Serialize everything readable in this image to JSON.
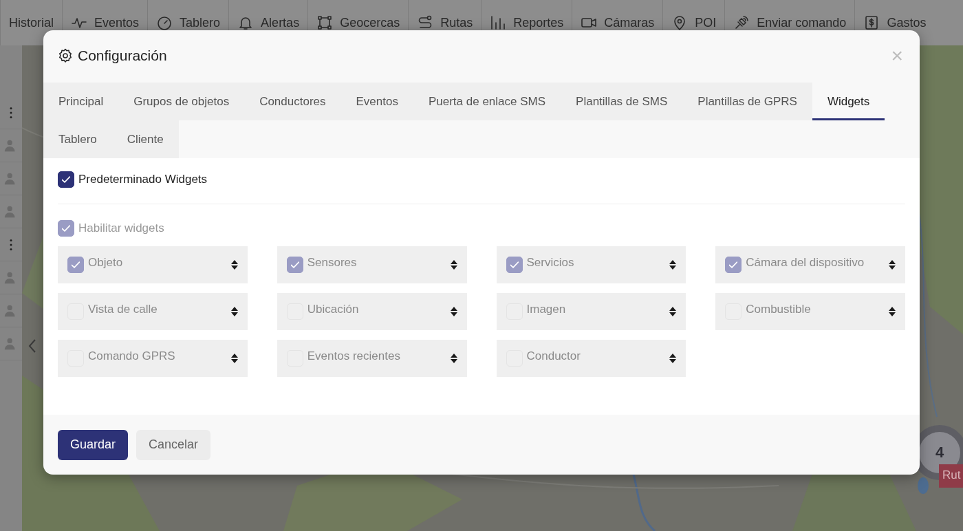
{
  "nav": {
    "items": [
      {
        "label": "Historial"
      },
      {
        "label": "Eventos"
      },
      {
        "label": "Tablero"
      },
      {
        "label": "Alertas"
      },
      {
        "label": "Geocercas"
      },
      {
        "label": "Rutas"
      },
      {
        "label": "Reportes"
      },
      {
        "label": "Cámaras"
      },
      {
        "label": "POI"
      },
      {
        "label": "Enviar comando"
      },
      {
        "label": "Gastos"
      }
    ]
  },
  "map": {
    "kind": "picture",
    "cluster": {
      "count": "4"
    },
    "tag": {
      "label": "Rut"
    }
  },
  "modal": {
    "title": "Configuración",
    "close": "×",
    "tabs": [
      {
        "label": "Principal",
        "selected": false
      },
      {
        "label": "Grupos de objetos",
        "selected": false
      },
      {
        "label": "Conductores",
        "selected": false
      },
      {
        "label": "Eventos",
        "selected": false
      },
      {
        "label": "Puerta de enlace SMS",
        "selected": false
      },
      {
        "label": "Plantillas de SMS",
        "selected": false
      },
      {
        "label": "Plantillas de GPRS",
        "selected": false
      },
      {
        "label": "Widgets",
        "selected": true
      },
      {
        "label": "Tablero",
        "selected": false
      },
      {
        "label": "Cliente",
        "selected": false
      }
    ],
    "default_widgets": {
      "label": "Predeterminado Widgets",
      "checked": true
    },
    "enable_widgets": {
      "label": "Habilitar widgets",
      "checked": true,
      "disabled": true
    },
    "widgets": [
      {
        "label": "Objeto",
        "checked": true
      },
      {
        "label": "Sensores",
        "checked": true
      },
      {
        "label": "Servicios",
        "checked": true
      },
      {
        "label": "Cámara del dispositivo",
        "checked": true
      },
      {
        "label": "Vista de calle",
        "checked": false
      },
      {
        "label": "Ubicación",
        "checked": false
      },
      {
        "label": "Imagen",
        "checked": false
      },
      {
        "label": "Combustible",
        "checked": false
      },
      {
        "label": "Comando GPRS",
        "checked": false
      },
      {
        "label": "Eventos recientes",
        "checked": false
      },
      {
        "label": "Conductor",
        "checked": false
      }
    ],
    "buttons": [
      {
        "label": "Guardar",
        "kind": "primary"
      },
      {
        "label": "Cancelar",
        "kind": "secondary"
      }
    ]
  }
}
